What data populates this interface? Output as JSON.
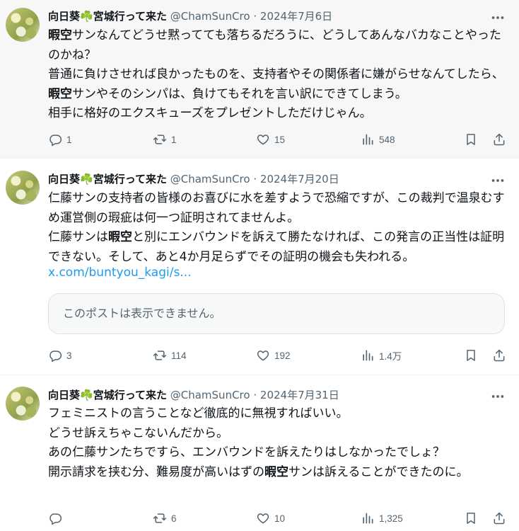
{
  "tweets": [
    {
      "author": "向日葵",
      "clover": "☘️",
      "author_suffix": "宮城行って来た",
      "handle": "@ChamSunCro",
      "separator": "·",
      "date": "2024年7月6日",
      "text_segments": [
        {
          "t": "暇空",
          "bold": true
        },
        {
          "t": "サンなんてどうせ黙ってても落ちるだろうに、どうしてあんなバカなことやったのかね？\n普通に負けさせれば良かったものを、支持者やその関係者に嫌がらせなんてしたら、"
        },
        {
          "t": "暇空",
          "bold": true
        },
        {
          "t": "サンやそのシンパは、負けてもそれを言い訳にできてしまう。\n相手に格好のエクスキューズをプレゼントしただけじゃん。"
        }
      ],
      "replies": "1",
      "retweets": "1",
      "likes": "15",
      "views": "548"
    },
    {
      "author": "向日葵",
      "clover": "☘️",
      "author_suffix": "宮城行って来た",
      "handle": "@ChamSunCro",
      "separator": "·",
      "date": "2024年7月20日",
      "text_segments": [
        {
          "t": "仁藤サンの支持者の皆様のお喜びに水を差すようで恐縮ですが、この裁判で温泉むすめ運営側の瑕疵は何一つ証明されてませんよ。\n仁藤サンは"
        },
        {
          "t": "暇空",
          "bold": true
        },
        {
          "t": "と別にエンバウンドを訴えて勝たなければ、この発言の正当性は証明できない。そして、あと4か月足らずでその証明の機会も失われる。"
        }
      ],
      "link": "x.com/buntyou_kagi/s...",
      "quote_text": "このポストは表示できません。",
      "replies": "3",
      "retweets": "114",
      "likes": "192",
      "views": "1.4万"
    },
    {
      "author": "向日葵",
      "clover": "☘️",
      "author_suffix": "宮城行って来た",
      "handle": "@ChamSunCro",
      "separator": "·",
      "date": "2024年7月31日",
      "text_segments": [
        {
          "t": "フェミニストの言うことなど徹底的に無視すればいい。\nどうせ訴えちゃこないんだから。\nあの仁藤サンたちですら、エンバウンドを訴えたりはしなかったでしょ？\n開示請求を挟む分、難易度が高いはずの"
        },
        {
          "t": "暇空",
          "bold": true
        },
        {
          "t": "サンは訴えることができたのに。"
        }
      ],
      "replies": "",
      "retweets": "6",
      "likes": "10",
      "views": "1,325"
    }
  ],
  "icons": {
    "reply": "reply-icon",
    "retweet": "retweet-icon",
    "like": "heart-icon",
    "views": "views-icon",
    "bookmark": "bookmark-icon",
    "share": "share-icon",
    "more": "more-icon"
  },
  "colors": {
    "link": "#1d9bf0",
    "secondary_text": "#536471",
    "highlight_bg": "#f7f7f7"
  }
}
